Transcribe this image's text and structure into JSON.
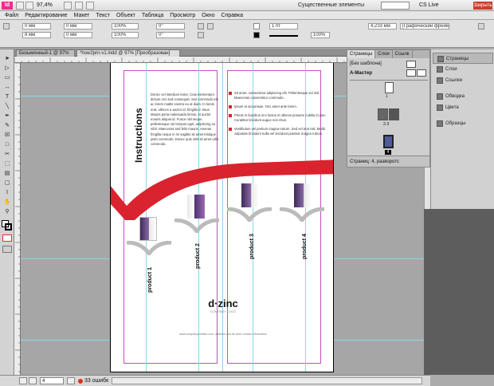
{
  "app": {
    "logo": "Id",
    "zoom": "97,4%",
    "workspace": "Существенные элементы",
    "cs_live": "CS Live",
    "close_tip": "Закрыть"
  },
  "menu": [
    "Файл",
    "Редактирование",
    "Макет",
    "Текст",
    "Объект",
    "Таблица",
    "Просмотр",
    "Окно",
    "Справка"
  ],
  "control": {
    "x": "0 мм",
    "y": "8 мм",
    "w": "0 мм",
    "h": "0 мм",
    "zoom1": "100%",
    "zoom2": "100%",
    "deg1": "0°",
    "deg2": "0°",
    "stroke": "1 пт",
    "pct": "100%",
    "size": "4,233 мм",
    "frame": "[Графический фрейм]"
  },
  "tabs": [
    "Безымянный-1 @ 97%",
    "*how2prn-v1.indd @ 97% [Преобразован]"
  ],
  "status": {
    "page": "4",
    "errors": "33 ошибк"
  },
  "pages_panel": {
    "tabs": [
      "Страницы",
      "Слои",
      "Ссылк"
    ],
    "none_master": "[Без шаблона]",
    "master": "A-Мастер",
    "numbers": [
      "1",
      "2-3",
      "4"
    ],
    "footer": "Страниц: 4, разворотс"
  },
  "side_panels": [
    "Страницы",
    "Слои",
    "Ссылки",
    "Обводка",
    "Цвета",
    "Образцы"
  ],
  "document": {
    "title": "Instructions",
    "left_text": "Donec vel interdum tortor. Cras elementum dictum orci sed consequat. Sed commodo est ac lorem mattis viverra eu at diam. In lorem erat, ultrices a auctor id, fringilla in risus. Mauris porta malesuada lectus, et auctor mauris aliquet id. Fusce nisl neque, pellentesque vel tempus eget, adipiscing eu nibh. Maecenas sed felis mauris. Aenean fringilla neque in mi sagittis sit amet tristique justo commodo. Donec quis velit sit amet odio commodo.",
    "bullets": [
      "Sit amet, consectetur adipiscing elit. Pellentesque vel nisl. Maecenas consectetur commodo.",
      "Ipsum et accumsan. Orci amet ante lorem.",
      "Primis in faucibus orci luctus et ultrices posuere cubilia Curae; Curabitur tincidunt augue non risus.",
      "Vestibulum vel pretium magna rutrum. Sed vel erat nisl. Morbi vulputate tincidunt nulla vel tincidunt pulvinar magna rutrum."
    ],
    "products": [
      "product 1",
      "product 2",
      "product 3",
      "product 4"
    ],
    "logo": "d·zinc",
    "logo_sub": "COMPANY LOGO",
    "footer_line": "www.companywebsite.com, address and all other contact information"
  },
  "colors": {
    "accent_red": "#d9232f",
    "guide": "#8bd8e8",
    "margin": "#c24fc2"
  }
}
